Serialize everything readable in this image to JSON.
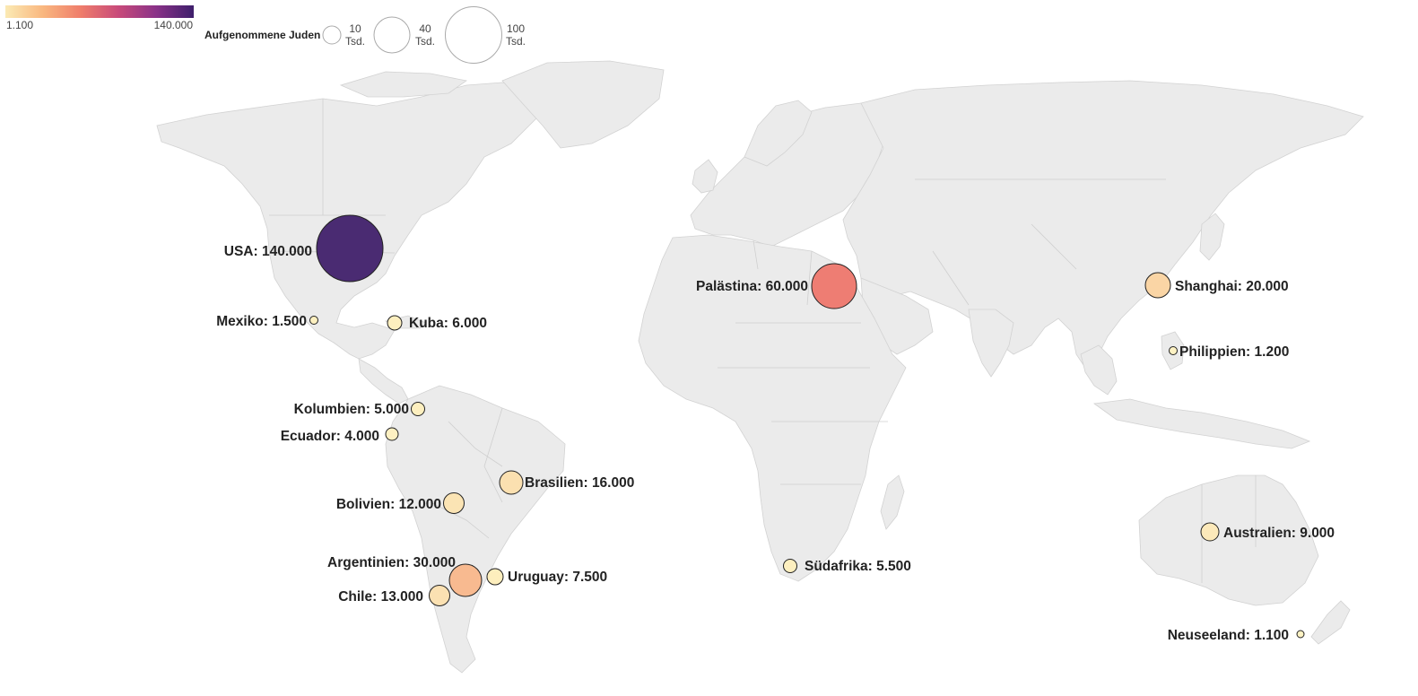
{
  "legend": {
    "color_min_label": "1.100",
    "color_max_label": "140.000",
    "color_min": "#fbe9b1",
    "color_max": "#3e1f6b",
    "gradient_stops": [
      "#fbeab4",
      "#f9b77f",
      "#ef7d6b",
      "#c84a7a",
      "#8a3288",
      "#3e1f6b"
    ],
    "size_title": "Aufgenommene Juden",
    "size_items": [
      {
        "value": 10,
        "line1": "10",
        "line2": "Tsd."
      },
      {
        "value": 40,
        "line1": "40",
        "line2": "Tsd."
      },
      {
        "value": 100,
        "line1": "100",
        "line2": "Tsd."
      }
    ]
  },
  "markers": [
    {
      "id": "usa",
      "name": "USA",
      "value": 140000,
      "label": "USA: 140.000",
      "color": "#4a2b72"
    },
    {
      "id": "mexiko",
      "name": "Mexiko",
      "value": 1500,
      "label": "Mexiko: 1.500",
      "color": "#fcf0c0"
    },
    {
      "id": "kuba",
      "name": "Kuba",
      "value": 6000,
      "label": "Kuba: 6.000",
      "color": "#fdefbf"
    },
    {
      "id": "kolumbien",
      "name": "Kolumbien",
      "value": 5000,
      "label": "Kolumbien: 5.000",
      "color": "#fdefbf"
    },
    {
      "id": "ecuador",
      "name": "Ecuador",
      "value": 4000,
      "label": "Ecuador: 4.000",
      "color": "#fdf0c2"
    },
    {
      "id": "brasilien",
      "name": "Brasilien",
      "value": 16000,
      "label": "Brasilien: 16.000",
      "color": "#fbe0b0"
    },
    {
      "id": "bolivien",
      "name": "Bolivien",
      "value": 12000,
      "label": "Bolivien: 12.000",
      "color": "#fbe4b4"
    },
    {
      "id": "argentinien",
      "name": "Argentinien",
      "value": 30000,
      "label": "Argentinien: 30.000",
      "color": "#f8ba90"
    },
    {
      "id": "uruguay",
      "name": "Uruguay",
      "value": 7500,
      "label": "Uruguay: 7.500",
      "color": "#fdeebd"
    },
    {
      "id": "chile",
      "name": "Chile",
      "value": 13000,
      "label": "Chile: 13.000",
      "color": "#fbe1b2"
    },
    {
      "id": "palaestina",
      "name": "Palästina",
      "value": 60000,
      "label": "Palästina: 60.000",
      "color": "#ee7d73"
    },
    {
      "id": "suedafrika",
      "name": "Südafrika",
      "value": 5500,
      "label": "Südafrika: 5.500",
      "color": "#fdefbf"
    },
    {
      "id": "shanghai",
      "name": "Shanghai",
      "value": 20000,
      "label": "Shanghai: 20.000",
      "color": "#fad5a5"
    },
    {
      "id": "philippien",
      "name": "Philippien",
      "value": 1200,
      "label": "Philippien: 1.200",
      "color": "#fdf2c3"
    },
    {
      "id": "australien",
      "name": "Australien",
      "value": 9000,
      "label": "Australien: 9.000",
      "color": "#fce9ba"
    },
    {
      "id": "neuseeland",
      "name": "Neuseeland",
      "value": 1100,
      "label": "Neuseeland: 1.100",
      "color": "#fdf2c3"
    }
  ]
}
